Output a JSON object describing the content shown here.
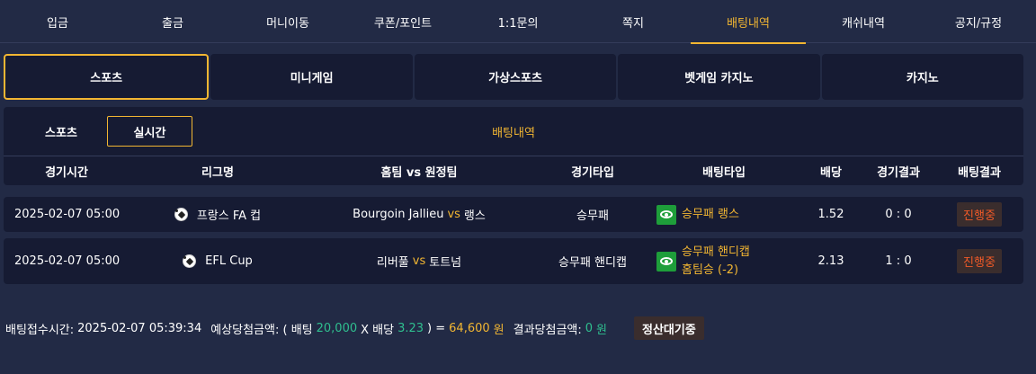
{
  "topnav": {
    "items": [
      {
        "label": "입금"
      },
      {
        "label": "출금"
      },
      {
        "label": "머니이동"
      },
      {
        "label": "쿠폰/포인트"
      },
      {
        "label": "1:1문의"
      },
      {
        "label": "쪽지"
      },
      {
        "label": "배팅내역"
      },
      {
        "label": "캐쉬내역"
      },
      {
        "label": "공지/규정"
      }
    ],
    "active": "배팅내역"
  },
  "categories": {
    "items": [
      {
        "label": "스포츠"
      },
      {
        "label": "미니게임"
      },
      {
        "label": "가상스포츠"
      },
      {
        "label": "벳게임 카지노"
      },
      {
        "label": "카지노"
      }
    ],
    "active": "스포츠"
  },
  "subtabs": {
    "sports": "스포츠",
    "live": "실시간",
    "active": "실시간"
  },
  "panel_title": "배팅내역",
  "table": {
    "columns": [
      "경기시간",
      "리그명",
      "홈팀 vs 원정팀",
      "경기타입",
      "배팅타입",
      "배당",
      "경기결과",
      "배팅결과"
    ],
    "rows": [
      {
        "time": "2025-02-07 05:00",
        "league": "프랑스 FA 컵",
        "home": "Bourgoin Jallieu",
        "vs": "vs",
        "away": "랭스",
        "game_type": "승무패",
        "bet_type_line1": "승무패 랭스",
        "bet_type_line2": "",
        "odds": "1.52",
        "score": "0 : 0",
        "status": "진행중"
      },
      {
        "time": "2025-02-07 05:00",
        "league": "EFL Cup",
        "home": "리버풀",
        "vs": "vs",
        "away": "토트넘",
        "game_type": "승무패 핸디캡",
        "bet_type_line1": "승무패 핸디캡",
        "bet_type_line2": "홈팀승 (-2)",
        "odds": "2.13",
        "score": "1 : 0",
        "status": "진행중"
      }
    ]
  },
  "footer": {
    "received_label": "배팅접수시간:",
    "received_time": "2025-02-07 05:39:34",
    "expected_label": "예상당첨금액: ( 배팅",
    "stake": "20,000",
    "x_odds_label": "X 배당",
    "total_odds": "3.23",
    "equals": ") =",
    "expected_amount": "64,600",
    "won_unit": "원",
    "result_label": "결과당첨금액:",
    "result_amount": "0",
    "result_unit": "원",
    "pending_label": "정산대기중"
  },
  "colors": {
    "accent": "#f2b632",
    "background": "#222a45",
    "panel": "#161b33",
    "status_text": "#f05a28",
    "amount_green": "#2fbf8f",
    "eye_badge": "#1e9e3a"
  }
}
